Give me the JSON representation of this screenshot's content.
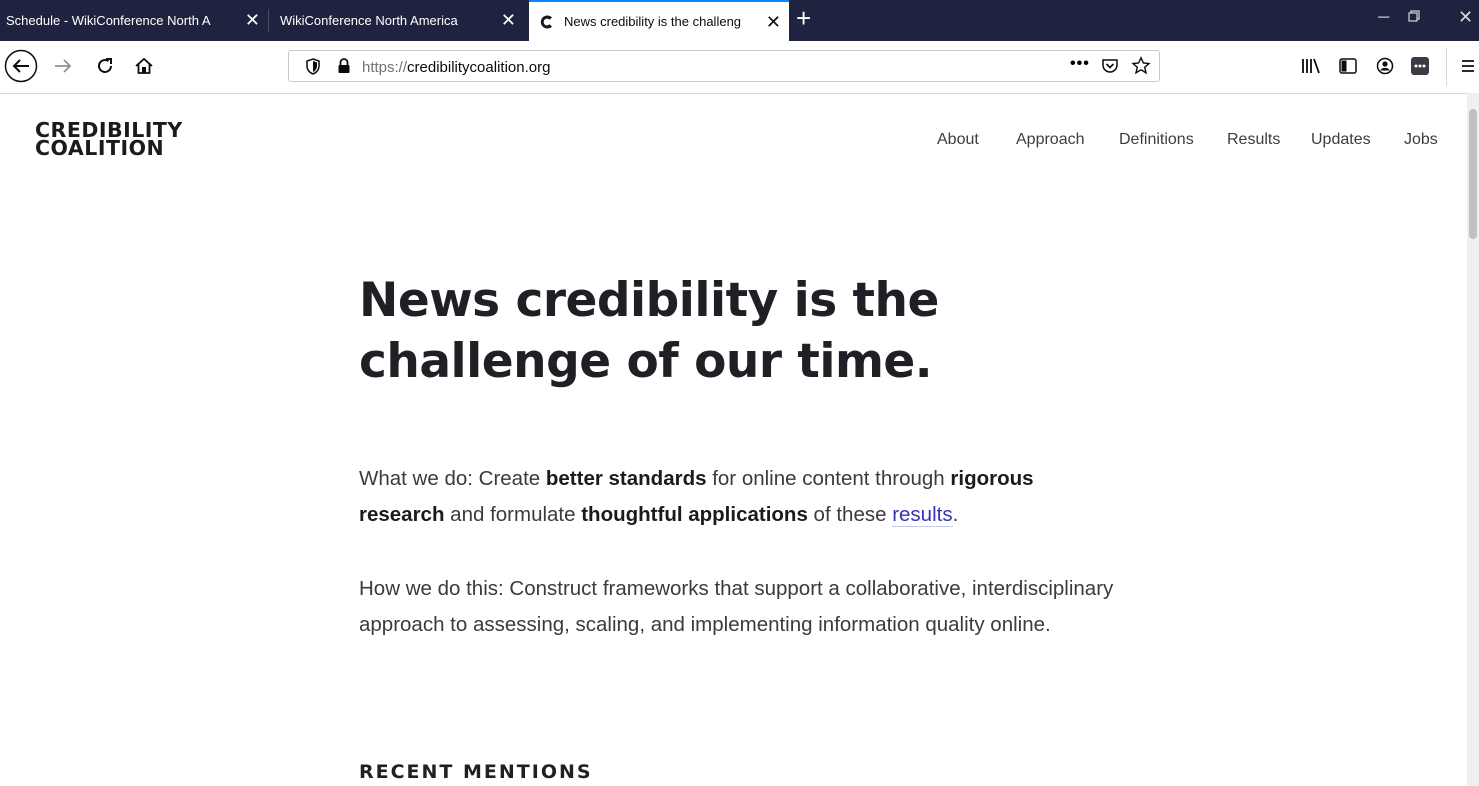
{
  "browser": {
    "tabs": [
      {
        "title": "Schedule - WikiConference North A",
        "active": false
      },
      {
        "title": "WikiConference North America",
        "active": false
      },
      {
        "title": "News credibility is the challeng",
        "active": true
      }
    ],
    "url_protocol": "https://",
    "url_host": "credibilitycoalition.org",
    "accent_color": "#0a84ff",
    "tabstrip_color": "#202340"
  },
  "site": {
    "logo_line1": "CREDIBILITY",
    "logo_line2": "COALITION",
    "nav": [
      "About",
      "Approach",
      "Definitions",
      "Results",
      "Updates",
      "Jobs"
    ]
  },
  "main": {
    "headline_line1": "News credibility is the",
    "headline_line2": "challenge of our time.",
    "what": {
      "t1": "What we do: Create ",
      "b1": "better standards",
      "t2": " for online content through ",
      "b2": "rigorous research",
      "t3": " and formulate ",
      "b3": "thoughtful applications",
      "t4": " of these ",
      "link": "results",
      "t5": "."
    },
    "how": "How we do this: Construct frameworks that support a collaborative, interdisciplinary approach to assessing, scaling, and implementing information quality online.",
    "recent_heading": "RECENT MENTIONS"
  }
}
